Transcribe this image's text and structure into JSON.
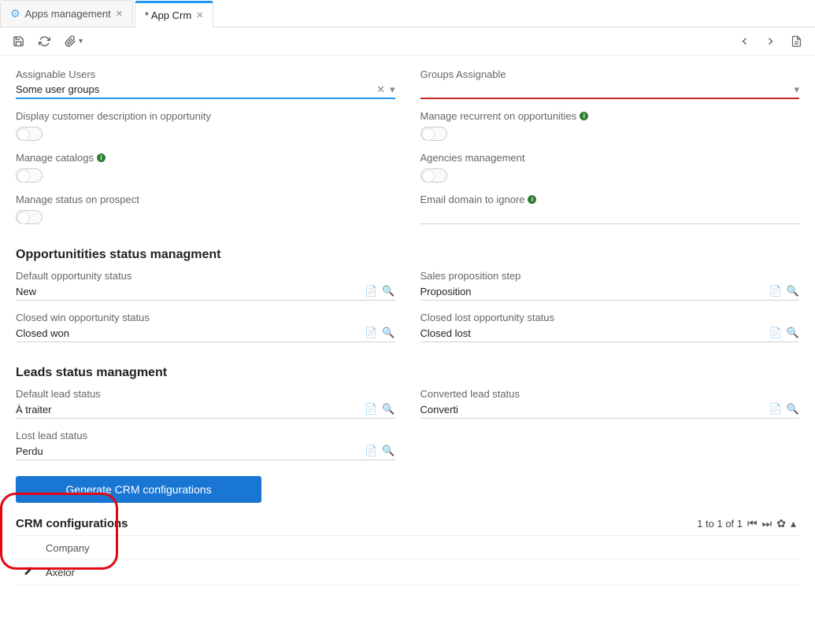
{
  "tabs": {
    "items": [
      {
        "label": "Apps management",
        "active": false
      },
      {
        "label": "* App Crm",
        "active": true
      }
    ]
  },
  "form": {
    "assignable_users": {
      "label": "Assignable Users",
      "value": "Some user groups"
    },
    "groups_assignable": {
      "label": "Groups Assignable",
      "value": ""
    },
    "display_customer_desc": {
      "label": "Display customer description in opportunity"
    },
    "manage_recurrent": {
      "label": "Manage recurrent on opportunities"
    },
    "manage_catalogs": {
      "label": "Manage catalogs"
    },
    "agencies_management": {
      "label": "Agencies management"
    },
    "manage_status_prospect": {
      "label": "Manage status on prospect"
    },
    "email_domain_ignore": {
      "label": "Email domain to ignore",
      "value": ""
    }
  },
  "opp_section": {
    "title": "Opportunitities status managment",
    "default_opp_status": {
      "label": "Default opportunity status",
      "value": "New"
    },
    "sales_proposition_step": {
      "label": "Sales proposition step",
      "value": "Proposition"
    },
    "closed_win": {
      "label": "Closed win opportunity status",
      "value": "Closed won"
    },
    "closed_lost": {
      "label": "Closed lost opportunity status",
      "value": "Closed lost"
    }
  },
  "leads_section": {
    "title": "Leads status managment",
    "default_lead_status": {
      "label": "Default lead status",
      "value": "À traiter"
    },
    "converted_lead_status": {
      "label": "Converted lead status",
      "value": "Converti"
    },
    "lost_lead_status": {
      "label": "Lost lead status",
      "value": "Perdu"
    }
  },
  "buttons": {
    "generate_crm": "Generate CRM configurations"
  },
  "subgrid": {
    "title": "CRM configurations",
    "pager_text": "1 to 1 of 1",
    "column_header": "Company",
    "rows": [
      {
        "company": "Axelor"
      }
    ]
  }
}
